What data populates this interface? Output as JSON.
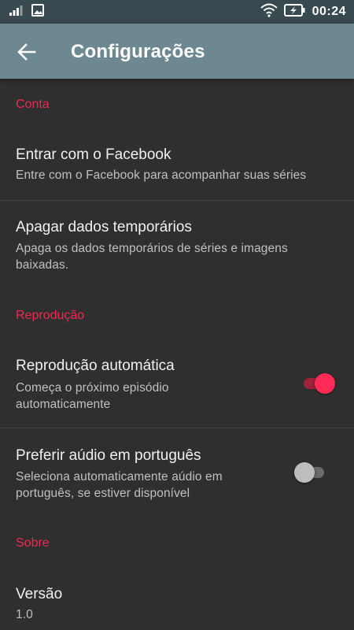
{
  "status_bar": {
    "time": "00:24",
    "icons": [
      "signal-icon",
      "image-notification-icon",
      "wifi-icon",
      "battery-charging-icon"
    ]
  },
  "app_bar": {
    "back_icon": "arrow-left-icon",
    "title": "Configurações"
  },
  "sections": {
    "account": {
      "header": "Conta",
      "facebook": {
        "title": "Entrar com o Facebook",
        "subtitle": "Entre com o Facebook para acompanhar suas séries"
      },
      "clear_cache": {
        "title": "Apagar dados temporários",
        "subtitle_line1": "Apaga os dados temporários de séries e imagens",
        "subtitle_line2": "baixadas."
      }
    },
    "playback": {
      "header": "Reprodução",
      "autoplay": {
        "title": "Reprodução automática",
        "subtitle_line1": "Começa o próximo episódio",
        "subtitle_line2": "automaticamente",
        "enabled": true
      },
      "portuguese_audio": {
        "title": "Preferir aúdio em português",
        "subtitle_line1": "Seleciona automaticamente aúdio em",
        "subtitle_line2": "português, se estiver disponível",
        "enabled": false
      }
    },
    "about": {
      "header": "Sobre",
      "version": {
        "title": "Versão",
        "value": "1.0"
      }
    }
  },
  "colors": {
    "accent": "#f0294f",
    "app_bar": "#6d8891",
    "status_bar": "#38494f",
    "background": "#2f2f2f"
  }
}
